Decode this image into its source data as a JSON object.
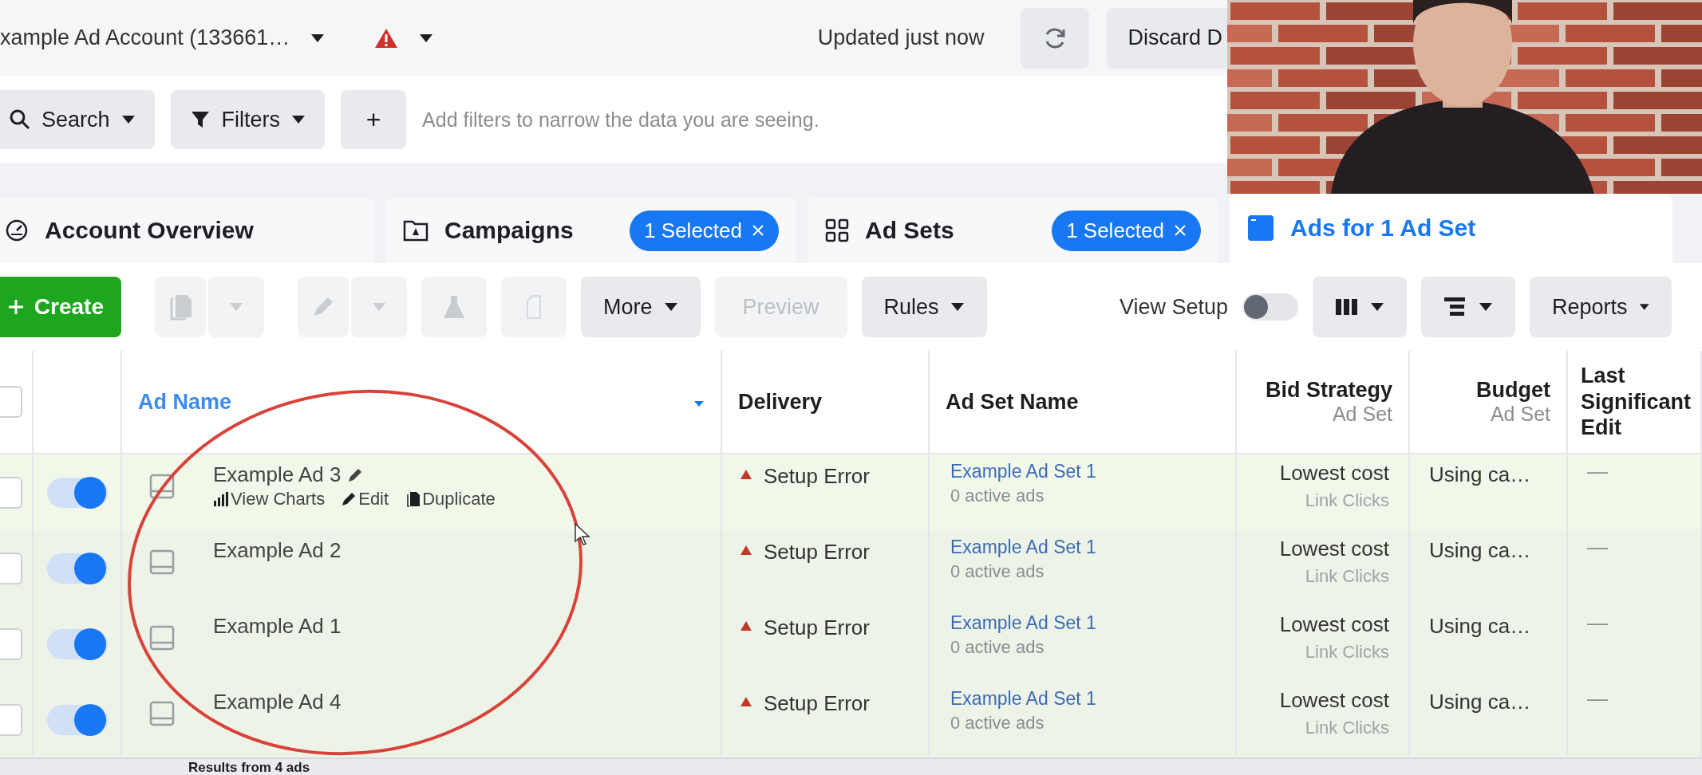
{
  "top_bar": {
    "account": "xample Ad Account (133661…",
    "status": "Updated just now",
    "discard_button": "Discard D"
  },
  "filter_bar": {
    "search_button": "Search",
    "filters_button": "Filters",
    "add_button": "+",
    "hint": "Add filters to narrow the data you are seeing."
  },
  "tabs": [
    {
      "kind": "overview",
      "label": "Account Overview",
      "selected": false
    },
    {
      "kind": "campaigns",
      "label": "Campaigns",
      "badge": "1 Selected",
      "selected": false
    },
    {
      "kind": "adsets",
      "label": "Ad Sets",
      "badge": "1 Selected",
      "selected": false
    },
    {
      "kind": "ads",
      "label": "Ads for 1 Ad Set",
      "selected": true
    }
  ],
  "toolbar": {
    "create_button": "Create",
    "more_button": "More",
    "preview_button": {
      "label": "Preview",
      "disabled": true
    },
    "rules_button": "Rules",
    "view_setup": {
      "label": "View Setup",
      "on": false
    },
    "reports_button": "Reports"
  },
  "table": {
    "select_all": {
      "checked": false
    },
    "columns": [
      {
        "title": "Ad Name",
        "sorted": true
      },
      {
        "title": "Delivery",
        "sorted": false
      },
      {
        "title": "Ad Set Name",
        "sorted": false
      },
      {
        "title": "Bid Strategy",
        "subtitle": "Ad Set",
        "sorted": false
      },
      {
        "title": "Budget",
        "subtitle": "Ad Set",
        "sorted": false
      },
      {
        "title": "Last Significant Edit",
        "sorted": false
      }
    ],
    "rows": [
      {
        "checked": false,
        "on": true,
        "ad_name": "Example Ad 3",
        "hovered": true,
        "actions": [
          "View Charts",
          "Edit",
          "Duplicate"
        ],
        "delivery": "Setup Error",
        "ad_set": "Example Ad Set 1",
        "ad_set_note": "0 active ads",
        "bid_strategy": "Lowest cost",
        "bid_note": "Link Clicks",
        "budget": "Using ca…",
        "last_edit": "—"
      },
      {
        "checked": false,
        "on": true,
        "ad_name": "Example Ad 2",
        "hovered": false,
        "delivery": "Setup Error",
        "ad_set": "Example Ad Set 1",
        "ad_set_note": "0 active ads",
        "bid_strategy": "Lowest cost",
        "bid_note": "Link Clicks",
        "budget": "Using ca…",
        "last_edit": "—"
      },
      {
        "checked": false,
        "on": true,
        "ad_name": "Example Ad 1",
        "hovered": false,
        "delivery": "Setup Error",
        "ad_set": "Example Ad Set 1",
        "ad_set_note": "0 active ads",
        "bid_strategy": "Lowest cost",
        "bid_note": "Link Clicks",
        "budget": "Using ca…",
        "last_edit": "—"
      },
      {
        "checked": false,
        "on": true,
        "ad_name": "Example Ad 4",
        "hovered": false,
        "delivery": "Setup Error",
        "ad_set": "Example Ad Set 1",
        "ad_set_note": "0 active ads",
        "bid_strategy": "Lowest cost",
        "bid_note": "Link Clicks",
        "budget": "Using ca…",
        "last_edit": "—"
      }
    ],
    "footer": "Results from 4 ads"
  }
}
